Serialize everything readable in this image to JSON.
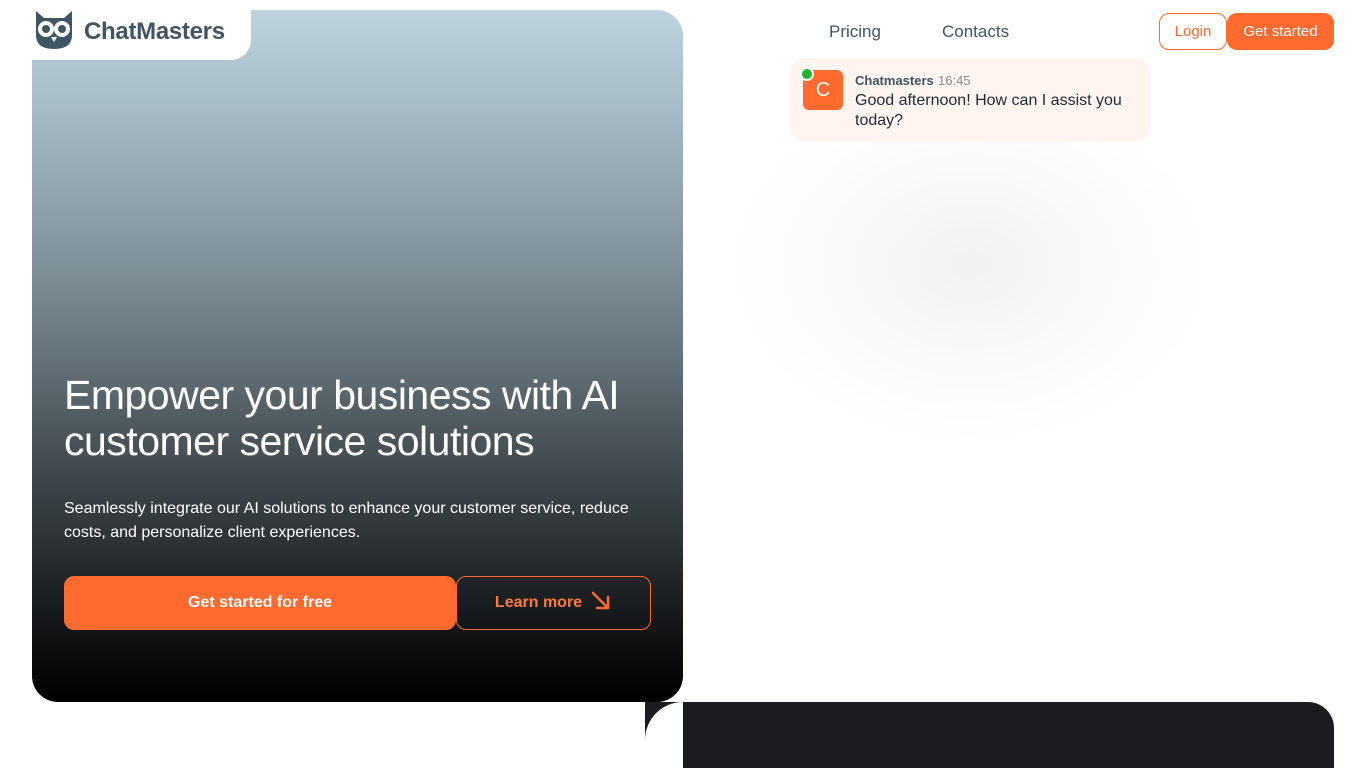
{
  "brand": {
    "name": "ChatMasters",
    "logo_icon": "owl-icon"
  },
  "nav": {
    "links": [
      "Pricing",
      "Contacts"
    ],
    "login_label": "Login",
    "get_started_label": "Get started"
  },
  "hero": {
    "title": "Empower your business with AI customer service solutions",
    "subtitle": "Seamlessly integrate our AI solutions to enhance your customer service, reduce costs, and personalize client experiences.",
    "primary_cta": "Get started for free",
    "secondary_cta": "Learn more",
    "secondary_cta_icon": "arrow-down-right-icon"
  },
  "chat": {
    "avatar_letter": "C",
    "sender": "Chatmasters",
    "time": "16:45",
    "message": "Good afternoon! How can I assist you today?",
    "status": "online"
  },
  "colors": {
    "accent": "#ff6b2f",
    "online": "#1fb531",
    "text": "#3f5561",
    "dark": "#1b1c20"
  }
}
